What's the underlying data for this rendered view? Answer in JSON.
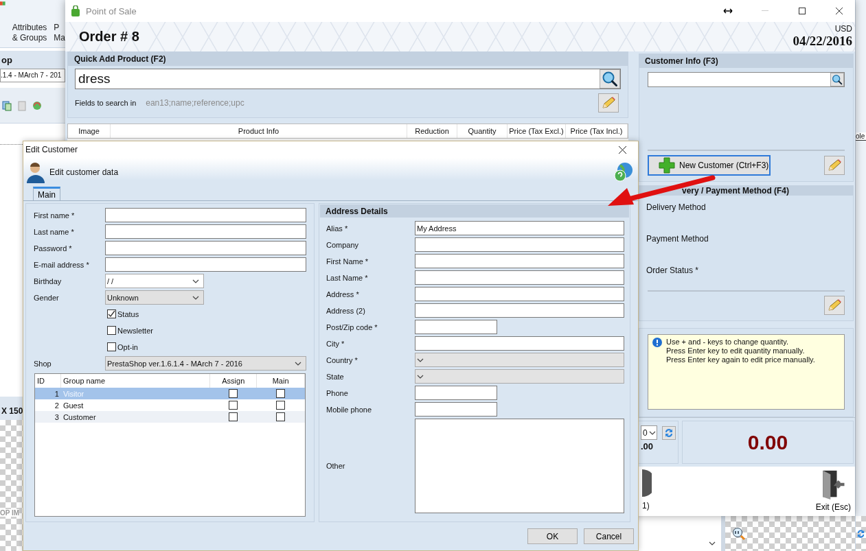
{
  "background_app": {
    "toolbar_items": [
      "Attributes\n& Groups",
      "P\nMa"
    ],
    "shop_heading": "op",
    "shop_value": ".1.4 - MArch 7 - 201",
    "thumb_size": "X 150",
    "thumb_placeholder": "OP IM",
    "column_fragment": "ole"
  },
  "pos_window": {
    "title": "Point of Sale",
    "order_title": "Order # 8",
    "currency": "USD",
    "date": "04/22/2016",
    "quick_add": {
      "heading": "Quick Add Product (F2)",
      "search_value": "dress",
      "fields_label": "Fields to search in",
      "fields_value": "ean13;name;reference;upc"
    },
    "product_table": {
      "columns": [
        "Image",
        "Product Info",
        "Reduction",
        "Quantity",
        "Price (Tax Excl.)",
        "Price (Tax Incl.)"
      ]
    },
    "customer_info": {
      "heading": "Customer Info (F3)",
      "new_customer_button": "New Customer (Ctrl+F3)"
    },
    "delivery_payment": {
      "heading": "very / Payment Method (F4)",
      "labels": [
        "Delivery Method",
        "Payment Method",
        "Order Status *"
      ]
    },
    "hint": {
      "lines": [
        "Use + and - keys to change quantity.",
        "Press Enter key to edit quantity manually.",
        "Press Enter key again to edit price manually."
      ]
    },
    "discount_select": "0",
    "subtotal": ".00",
    "total": "0.00",
    "pay_label": "1)",
    "exit_button": "Exit (Esc)"
  },
  "edit_customer": {
    "title": "Edit Customer",
    "subtitle": "Edit customer data",
    "tabs": [
      {
        "label": "Main",
        "selected": true
      }
    ],
    "customer_fields": [
      {
        "kind": "text",
        "label": "First name *"
      },
      {
        "kind": "text",
        "label": "Last name *"
      },
      {
        "kind": "text",
        "label": "Password *"
      },
      {
        "kind": "text",
        "label": "E-mail address *"
      },
      {
        "kind": "date",
        "label": "Birthday",
        "value": "/ /"
      },
      {
        "kind": "select",
        "label": "Gender",
        "value": "Unknown"
      },
      {
        "kind": "checkbox",
        "label": "Status",
        "checked": true
      },
      {
        "kind": "checkbox",
        "label": "Newsletter",
        "checked": false
      },
      {
        "kind": "checkbox",
        "label": "Opt-in",
        "checked": false
      },
      {
        "kind": "wide_select",
        "label": "Shop",
        "value": "PrestaShop ver.1.6.1.4 - MArch 7 - 2016"
      }
    ],
    "groups": {
      "columns": [
        "ID",
        "Group name",
        "Assign",
        "Main"
      ],
      "rows": [
        {
          "id": "1",
          "name": "Visitor",
          "assign": false,
          "main": false,
          "selected": true
        },
        {
          "id": "2",
          "name": "Guest",
          "assign": false,
          "main": false,
          "selected": false
        },
        {
          "id": "3",
          "name": "Customer",
          "assign": false,
          "main": false,
          "selected": false
        }
      ]
    },
    "address": {
      "heading": "Address Details",
      "fields": [
        {
          "kind": "text",
          "label": "Alias *",
          "value": "My Address"
        },
        {
          "kind": "text",
          "label": "Company"
        },
        {
          "kind": "text",
          "label": "First Name *"
        },
        {
          "kind": "text",
          "label": "Last Name *"
        },
        {
          "kind": "text",
          "label": "Address *"
        },
        {
          "kind": "text",
          "label": "Address (2)"
        },
        {
          "kind": "short",
          "label": "Post/Zip code *"
        },
        {
          "kind": "text",
          "label": "City *"
        },
        {
          "kind": "select",
          "label": "Country *"
        },
        {
          "kind": "select",
          "label": "State"
        },
        {
          "kind": "short",
          "label": "Phone"
        },
        {
          "kind": "short",
          "label": "Mobile phone"
        },
        {
          "kind": "area",
          "label": "Other"
        }
      ]
    },
    "buttons": [
      "OK",
      "Cancel"
    ]
  }
}
